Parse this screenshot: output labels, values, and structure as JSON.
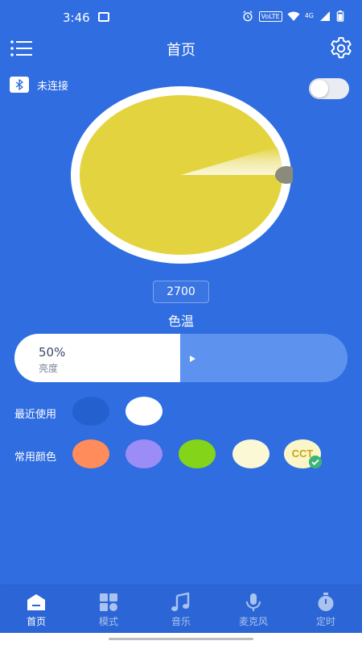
{
  "status_bar": {
    "time": "3:46",
    "network_badge": "VoLTE",
    "network_type": "4G"
  },
  "header": {
    "title": "首页"
  },
  "connection": {
    "status_label": "未连接",
    "toggle_on": false
  },
  "color_wheel": {
    "value": "2700",
    "label": "色温"
  },
  "brightness": {
    "percent_text": "50%",
    "level": 0.5,
    "label": "亮度"
  },
  "recent": {
    "label": "最近使用",
    "colors": [
      "#2560cf",
      "#ffffff"
    ]
  },
  "common": {
    "label": "常用颜色",
    "colors": [
      "#ff8c5a",
      "#9b8cf7",
      "#84d419",
      "#fbf8d5"
    ],
    "cct_label": "CCT"
  },
  "colors": {
    "background": "#2f6de0",
    "wheel_yellow": "#e3d43f",
    "nav_background": "#2c66d6",
    "check_green": "#3cb479"
  },
  "bottom_nav": {
    "items": [
      {
        "label": "首页",
        "icon": "home-icon",
        "active": true
      },
      {
        "label": "模式",
        "icon": "grid-icon",
        "active": false
      },
      {
        "label": "音乐",
        "icon": "music-icon",
        "active": false
      },
      {
        "label": "麦克风",
        "icon": "microphone-icon",
        "active": false
      },
      {
        "label": "定时",
        "icon": "timer-icon",
        "active": false
      }
    ]
  }
}
